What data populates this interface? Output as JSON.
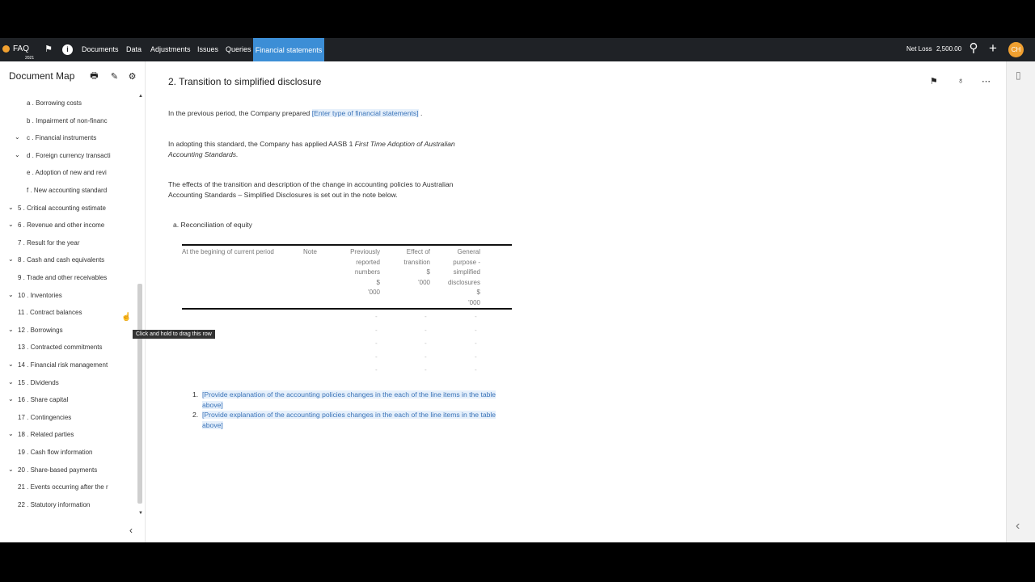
{
  "topnav": {
    "faq": "FAQ",
    "year": "2021",
    "items": [
      "Documents",
      "Data",
      "Adjustments",
      "Issues",
      "Queries"
    ],
    "active": "Financial statements",
    "net_loss_label": "Net Loss",
    "net_loss_value": "2,500.00",
    "avatar": "CH",
    "accent": "#3c8ed6"
  },
  "sidebar": {
    "title": "Document Map",
    "items": [
      {
        "label": "a . Borrowing costs",
        "chevron": false
      },
      {
        "label": "b . Impairment of non-financ",
        "chevron": false
      },
      {
        "label": "c . Financial instruments",
        "chevron": true
      },
      {
        "label": "d . Foreign currency transacti",
        "chevron": true
      },
      {
        "label": "e . Adoption of new and revi",
        "chevron": false
      },
      {
        "label": "f . New accounting standard",
        "chevron": false
      },
      {
        "label": "5 . Critical accounting estimate",
        "chevron": true
      },
      {
        "label": "6 . Revenue and other income",
        "chevron": true
      },
      {
        "label": "7 . Result for the year",
        "chevron": false
      },
      {
        "label": "8 . Cash and cash equivalents",
        "chevron": true
      },
      {
        "label": "9 . Trade and other receivables",
        "chevron": false
      },
      {
        "label": "10 . Inventories",
        "chevron": true
      },
      {
        "label": "11 . Contract balances",
        "chevron": false
      },
      {
        "label": "12 . Borrowings",
        "chevron": true
      },
      {
        "label": "13 . Contracted commitments",
        "chevron": false
      },
      {
        "label": "14 . Financial risk management",
        "chevron": true
      },
      {
        "label": "15 . Dividends",
        "chevron": true
      },
      {
        "label": "16 . Share capital",
        "chevron": true
      },
      {
        "label": "17 . Contingencies",
        "chevron": false
      },
      {
        "label": "18 . Related parties",
        "chevron": true
      },
      {
        "label": "19 . Cash flow information",
        "chevron": false
      },
      {
        "label": "20 . Share-based payments",
        "chevron": true
      },
      {
        "label": "21 . Events occurring after the r",
        "chevron": false
      },
      {
        "label": "22 . Statutory information",
        "chevron": false
      }
    ],
    "tooltip": "Click and hold to drag this row"
  },
  "document": {
    "title": "2. Transition to simplified disclosure",
    "para1_prefix": "In the previous period, the Company prepared",
    "para1_placeholder": "[Enter type of financial statements]",
    "para1_suffix": ".",
    "para2_prefix": "In adopting this standard, the Company has applied AASB 1",
    "para2_italic": "First Time Adoption of Australian Accounting Standards.",
    "para3": "The effects of the transition and description of the change in accounting policies to Australian Accounting Standards – Simplified Disclosures is set out in the note below.",
    "subtitle": "a. Reconciliation of equity",
    "table": {
      "headers": {
        "col1": "At the begining of current period",
        "col2": "Note",
        "col3": [
          "Previously",
          "reported",
          "numbers",
          "$",
          "'000"
        ],
        "col4": [
          "Effect of",
          "transition",
          "$",
          "'000"
        ],
        "col5": [
          "General",
          "purpose -",
          "simplified",
          "disclosures",
          "$",
          "'000"
        ]
      },
      "dash": "-"
    },
    "notes": [
      {
        "num": "1.",
        "text": "[Provide explanation of the accounting policies changes in the each of the line items in the table above]"
      },
      {
        "num": "2.",
        "text": "[Provide explanation of the accounting policies changes in the each of the line items in the table above]"
      }
    ]
  }
}
